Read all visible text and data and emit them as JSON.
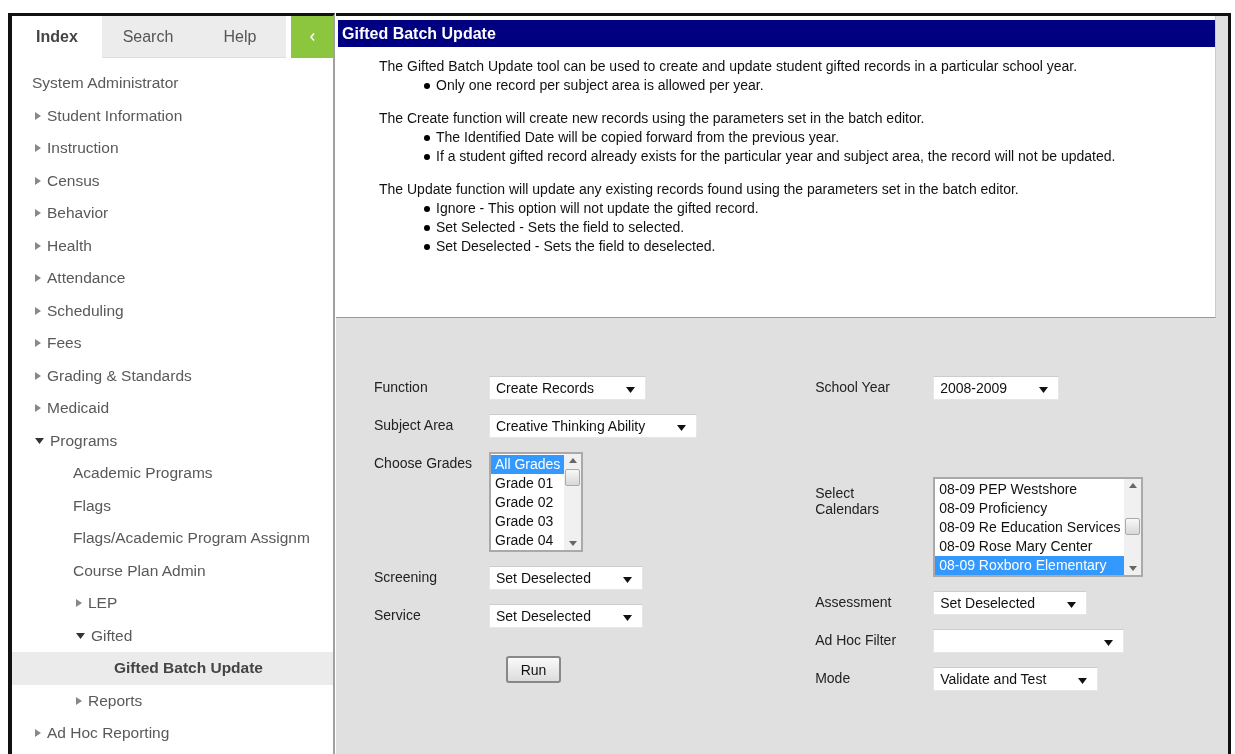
{
  "sidebar": {
    "tabs": [
      {
        "label": "Index",
        "selected": true
      },
      {
        "label": "Search",
        "selected": false
      },
      {
        "label": "Help",
        "selected": false
      }
    ],
    "tree": [
      {
        "label": "System Administrator",
        "selected": false,
        "children": [
          {
            "label": "Student Information",
            "expanded": false,
            "selected": false
          },
          {
            "label": "Instruction",
            "expanded": false,
            "selected": false
          },
          {
            "label": "Census",
            "expanded": false,
            "selected": false
          },
          {
            "label": "Behavior",
            "expanded": false,
            "selected": false
          },
          {
            "label": "Health",
            "expanded": false,
            "selected": false
          },
          {
            "label": "Attendance",
            "expanded": false,
            "selected": false
          },
          {
            "label": "Scheduling",
            "expanded": false,
            "selected": false
          },
          {
            "label": "Fees",
            "expanded": false,
            "selected": false
          },
          {
            "label": "Grading & Standards",
            "expanded": false,
            "selected": false
          },
          {
            "label": "Medicaid",
            "expanded": false,
            "selected": false
          },
          {
            "label": "Programs",
            "expanded": true,
            "selected": false,
            "children": [
              {
                "label": "Academic Programs",
                "selected": false
              },
              {
                "label": "Flags",
                "selected": false
              },
              {
                "label": "Flags/Academic Program Assignm",
                "selected": false
              },
              {
                "label": "Course Plan Admin",
                "selected": false
              },
              {
                "label": "LEP",
                "expanded": false,
                "selected": false
              },
              {
                "label": "Gifted",
                "expanded": true,
                "selected": false,
                "children": [
                  {
                    "label": "Gifted Batch Update",
                    "selected": true
                  }
                ]
              },
              {
                "label": "Reports",
                "expanded": false,
                "selected": false
              }
            ]
          },
          {
            "label": "Ad Hoc Reporting",
            "expanded": false,
            "selected": false
          }
        ]
      }
    ]
  },
  "panel": {
    "title": "Gifted Batch Update",
    "intro": [
      {
        "text": "The Gifted Batch Update tool can be used to create and update student gifted records in a particular school year.",
        "bullets": [
          "Only one record per subject area is allowed per year."
        ]
      },
      {
        "text": "The Create function will create new records using the parameters set in the batch editor.",
        "bullets": [
          "The Identified Date will be copied forward from the previous year.",
          "If a student gifted record already exists for the particular year and subject area, the record will not be updated."
        ]
      },
      {
        "text": "The Update function will update any existing records found using the parameters set in the batch editor.",
        "bullets": [
          "Ignore - This option will not update the gifted record.",
          "Set Selected - Sets the field to selected.",
          "Set Deselected - Sets the field to deselected."
        ]
      }
    ],
    "form": {
      "left": [
        {
          "kind": "select",
          "label": "Function",
          "value": "Create Records"
        },
        {
          "kind": "select",
          "label": "Subject Area",
          "value": "Creative Thinking Ability"
        },
        {
          "kind": "listbox",
          "label": "Choose Grades",
          "options": [
            {
              "label": "All Grades",
              "selected": true
            },
            {
              "label": "Grade 01",
              "selected": false
            },
            {
              "label": "Grade 02",
              "selected": false
            },
            {
              "label": "Grade 03",
              "selected": false
            },
            {
              "label": "Grade 04",
              "selected": false
            }
          ]
        },
        {
          "kind": "select",
          "label": "Screening",
          "value": "Set Deselected"
        },
        {
          "kind": "select",
          "label": "Service",
          "value": "Set Deselected"
        }
      ],
      "right": [
        {
          "kind": "select",
          "label": "School Year",
          "value": "2008-2009"
        },
        {
          "kind": "listbox",
          "label": "Select Calendars",
          "options": [
            {
              "label": "08-09 PEP Westshore",
              "selected": false
            },
            {
              "label": "08-09 Proficiency",
              "selected": false
            },
            {
              "label": "08-09 Re Education Services",
              "selected": false
            },
            {
              "label": "08-09 Rose Mary Center",
              "selected": false
            },
            {
              "label": "08-09 Roxboro Elementary",
              "selected": true
            }
          ]
        },
        {
          "kind": "select",
          "label": "Assessment",
          "value": "Set Deselected"
        },
        {
          "kind": "select",
          "label": "Ad Hoc Filter"
        },
        {
          "kind": "select",
          "label": "Mode",
          "value": "Validate and Test"
        }
      ],
      "run_button": "Run"
    }
  }
}
